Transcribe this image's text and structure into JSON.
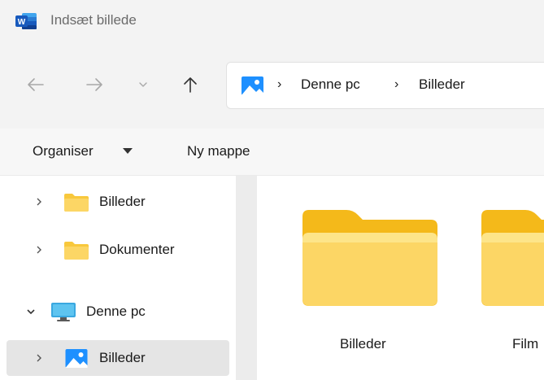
{
  "window": {
    "app_icon": "word-icon",
    "title": "Indsæt billede"
  },
  "nav": {
    "back_icon": "arrow-left-icon",
    "forward_icon": "arrow-right-icon",
    "recent_icon": "chevron-down-icon",
    "up_icon": "arrow-up-icon"
  },
  "address": {
    "location_icon": "pictures-icon",
    "breadcrumbs": [
      "Denne pc",
      "Billeder"
    ]
  },
  "commands": {
    "organize_label": "Organiser",
    "new_folder_label": "Ny mappe"
  },
  "sidebar": {
    "items": [
      {
        "label": "Billeder",
        "icon": "folder-icon",
        "expanded": false,
        "selected": false
      },
      {
        "label": "Dokumenter",
        "icon": "folder-icon",
        "expanded": false,
        "selected": false
      },
      {
        "label": "Denne pc",
        "icon": "computer-icon",
        "expanded": true,
        "selected": false
      },
      {
        "label": "Billeder",
        "icon": "pictures-icon",
        "expanded": false,
        "selected": true
      }
    ]
  },
  "content": {
    "items": [
      {
        "label": "Billeder",
        "icon": "folder-icon"
      },
      {
        "label": "Film",
        "icon": "folder-icon"
      }
    ]
  },
  "colors": {
    "folder_yellow": "#f8c83c",
    "folder_light": "#fde58a",
    "accent_blue": "#1a73e8",
    "selection": "#e5e5e5"
  }
}
